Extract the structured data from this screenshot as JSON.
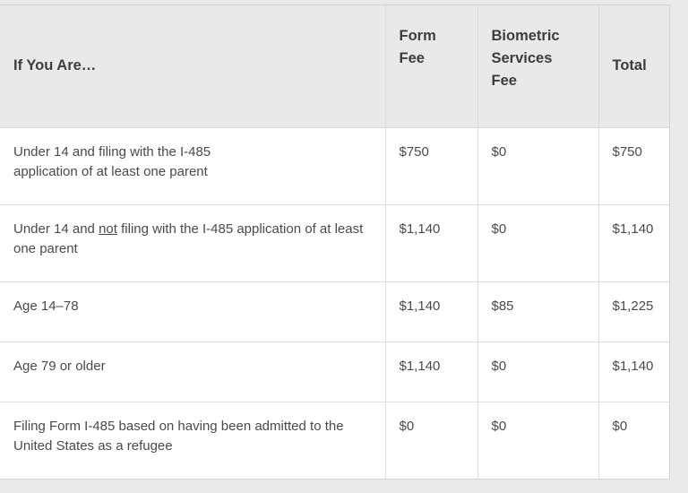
{
  "table": {
    "columns": [
      {
        "key": "desc",
        "label": "If You Are…"
      },
      {
        "key": "form",
        "label": "Form Fee"
      },
      {
        "key": "bio",
        "label": "Biometric Services Fee"
      },
      {
        "key": "total",
        "label": "Total"
      }
    ],
    "header": {
      "desc": "If You Are…",
      "form_line1": "Form",
      "form_line2": "Fee",
      "bio_line1": "Biometric",
      "bio_line2": "Services",
      "bio_line3": "Fee",
      "total": "Total"
    },
    "rows": [
      {
        "desc_line1": "Under 14 and filing with the I-485",
        "desc_line2": "application of at least one parent",
        "desc_plain": "Under 14 and filing with the I-485 application of at least one parent",
        "form_fee": "$750",
        "biometric_fee": "$0",
        "total": "$750"
      },
      {
        "desc_pre": "Under 14 and ",
        "desc_emphasis": "not",
        "desc_post": " filing with the I-485 application of at least one parent",
        "desc_plain": "Under 14 and not filing with the I-485 application of at least one parent",
        "form_fee": "$1,140",
        "biometric_fee": "$0",
        "total": "$1,140"
      },
      {
        "desc_plain": "Age 14–78",
        "form_fee": "$1,140",
        "biometric_fee": "$85",
        "total": "$1,225"
      },
      {
        "desc_plain": "Age 79 or older",
        "form_fee": "$1,140",
        "biometric_fee": "$0",
        "total": "$1,140"
      },
      {
        "desc_line1": "Filing Form I-485 based on having been admitted to the",
        "desc_line2": "United States as a refugee",
        "desc_plain": "Filing Form I-485 based on having been admitted to the United States as a refugee",
        "form_fee": "$0",
        "biometric_fee": "$0",
        "total": "$0"
      }
    ]
  },
  "colors": {
    "page_background": "#eaeaea",
    "header_background": "#e9e9e9",
    "cell_background": "#ffffff",
    "border": "#dedede",
    "header_text": "#3d3d3d",
    "body_text": "#4a4a4a"
  }
}
